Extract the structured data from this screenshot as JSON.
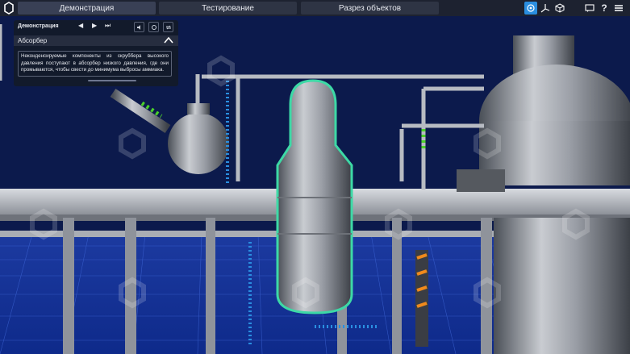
{
  "header": {
    "tabs": [
      {
        "label": "Демонстрация"
      },
      {
        "label": "Тестирование"
      },
      {
        "label": "Разрез объектов"
      }
    ],
    "icons": [
      "view-3d-icon",
      "axes-icon",
      "cube-icon",
      "chat-icon",
      "help-icon",
      "menu-icon"
    ],
    "help_glyph": "?"
  },
  "panel": {
    "title": "Демонстрация",
    "section_title": "Абсорбер",
    "description": "Неконденсируемые компоненты из скруббера высокого давления поступают в абсорбер низкого давления, где они промываются, чтобы свести до минимума выбросы аммиака."
  },
  "colors": {
    "accent": "#2a8ee0",
    "highlight": "#3dd9a6",
    "background": "#0b1a4a"
  }
}
